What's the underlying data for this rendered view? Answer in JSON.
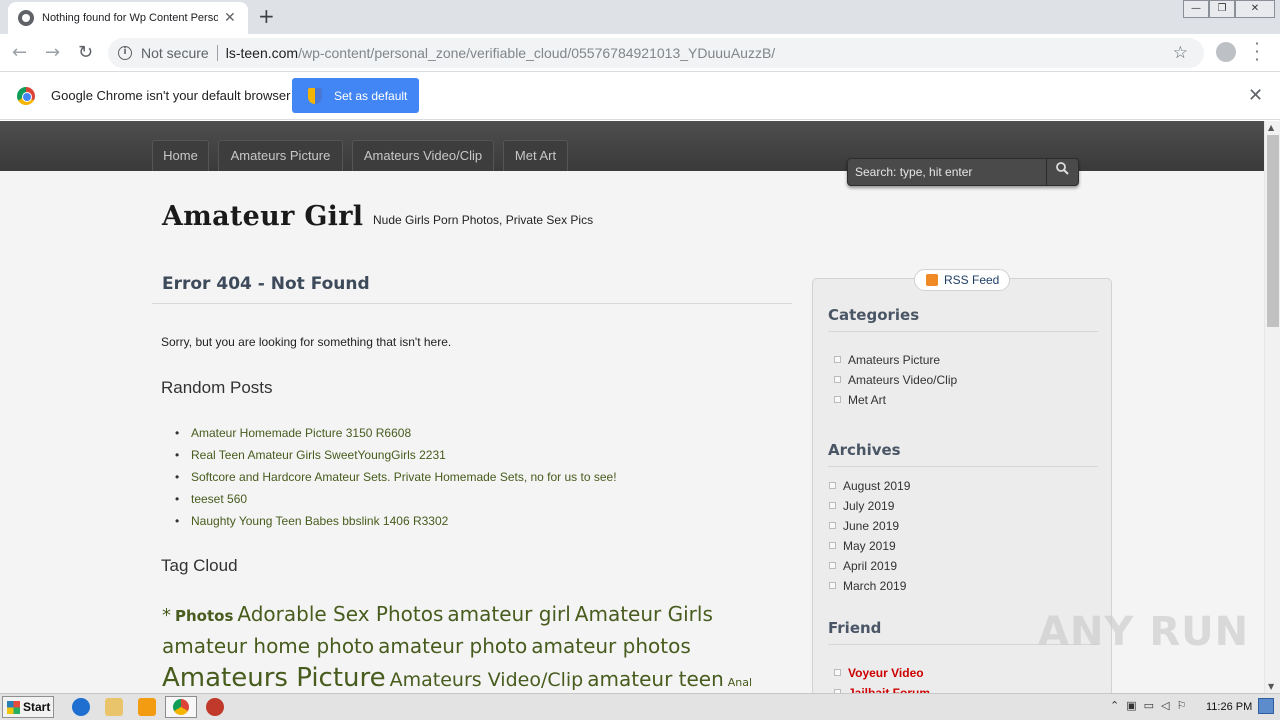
{
  "browser": {
    "tab_title": "Nothing found for Wp Content Personal Zone",
    "new_tab": "+",
    "tab_close": "✕",
    "not_secure": "Not secure",
    "url_domain": "ls-teen.com",
    "url_path": "/wp-content/personal_zone/verifiable_cloud/05576784921013_YDuuuAuzzB/",
    "window_controls": [
      "—",
      "❐",
      "✕"
    ]
  },
  "infobar": {
    "message": "Google Chrome isn't your default browser",
    "button": "Set as default",
    "close": "✕"
  },
  "site": {
    "nav": [
      "Home",
      "Amateurs Picture",
      "Amateurs Video/Clip",
      "Met Art"
    ],
    "search_placeholder": "Search: type, hit enter",
    "title": "Amateur Girl",
    "description": "Nude Girls Porn Photos, Private Sex Pics"
  },
  "main": {
    "error_title": "Error 404 - Not Found",
    "sorry": "Sorry, but you are looking for something that isn't here.",
    "random_posts_heading": "Random Posts",
    "random_posts": [
      "Amateur Homemade Picture 3150 R6608",
      "Real Teen Amateur Girls SweetYoungGirls 2231",
      "Softcore and Hardcore Amateur Sets. Private Homemade Sets, no for us to see!",
      "teeset 560",
      "Naughty Young Teen Babes bbslink 1406 R3302"
    ],
    "tag_cloud_heading": "Tag Cloud",
    "tags": [
      "*",
      "Photos",
      "Adorable Sex Photos",
      "amateur girl",
      "Amateur Girls",
      "amateur home photo",
      "amateur photo",
      "amateur photos",
      "Amateurs Picture",
      "Amateurs Video/Clip",
      "amateur teen",
      "Anal"
    ]
  },
  "sidebar": {
    "rss": "RSS Feed",
    "categories_heading": "Categories",
    "categories": [
      "Amateurs Picture",
      "Amateurs Video/Clip",
      "Met Art"
    ],
    "archives_heading": "Archives",
    "archives": [
      "August 2019",
      "July 2019",
      "June 2019",
      "May 2019",
      "April 2019",
      "March 2019"
    ],
    "friend_heading": "Friend",
    "friends": [
      "Voyeur Video",
      "Jailbait Forum"
    ]
  },
  "watermark": "ANY RUN",
  "taskbar": {
    "start": "Start",
    "clock": "11:26 PM"
  },
  "icons": {
    "back": "←",
    "forward": "→",
    "reload": "↻",
    "star": "☆",
    "search": "🔍",
    "menu": "⋮"
  }
}
